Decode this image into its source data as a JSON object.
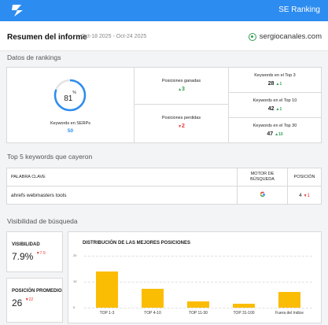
{
  "header": {
    "brand": "SE Ranking"
  },
  "report": {
    "title": "Resumen del informe",
    "date_range": "Oct-18 2025 - Oct-24 2025",
    "domain": "sergiocanales.com"
  },
  "rankings": {
    "section_title": "Datos de rankings",
    "serp_percent": "81",
    "serp_percent_fraction": 0.81,
    "serp_percent_sign": "%",
    "serp_label": "Keywords en SERPs",
    "serp_count": "50",
    "gained_label": "Posiciones ganadas",
    "gained_value": "3",
    "lost_label": "Posiciones perdidas",
    "lost_value": "2",
    "top3_label": "Keywords en el Top 3",
    "top3_value": "28",
    "top3_change": "1",
    "top10_label": "Keywords en el Top 10",
    "top10_value": "42",
    "top10_change": "1",
    "top30_label": "Keywords en el Top 30",
    "top30_value": "47",
    "top30_change": "10"
  },
  "fallen": {
    "section_title": "Top 5 keywords que cayeron",
    "col_keyword": "PALABRA CLAVE",
    "col_engine_line1": "MOTOR DE",
    "col_engine_line2": "BÚSQUEDA",
    "col_position": "POSICIÓN",
    "rows": [
      {
        "keyword": "ahrefs webmasters tools",
        "engine_icon": "google-icon",
        "position": "4",
        "change": "1"
      }
    ]
  },
  "visibility": {
    "section_title": "Visibilidad de búsqueda",
    "visibility_label": "VISIBILIDAD",
    "visibility_value": "7.9%",
    "visibility_change": "7.9",
    "avg_position_label": "POSICIÓN PROMEDIO",
    "avg_position_value": "26",
    "avg_position_change": "22"
  },
  "chart_data": {
    "type": "bar",
    "title": "DISTRIBUCIÓN DE LAS MEJORES POSICIONES",
    "categories": [
      "TOP 1-3",
      "TOP 4-10",
      "TOP 11-30",
      "TOP 31-100",
      "Fuera del índice"
    ],
    "values": [
      14,
      7.2,
      2.5,
      1.5,
      6
    ],
    "yticks": [
      "0",
      "10",
      "20"
    ],
    "ylim": [
      0,
      20
    ],
    "color": "#fbbc04"
  },
  "colors": {
    "accent": "#2d8cf0",
    "up": "#2e9d4f",
    "down": "#e53935"
  }
}
